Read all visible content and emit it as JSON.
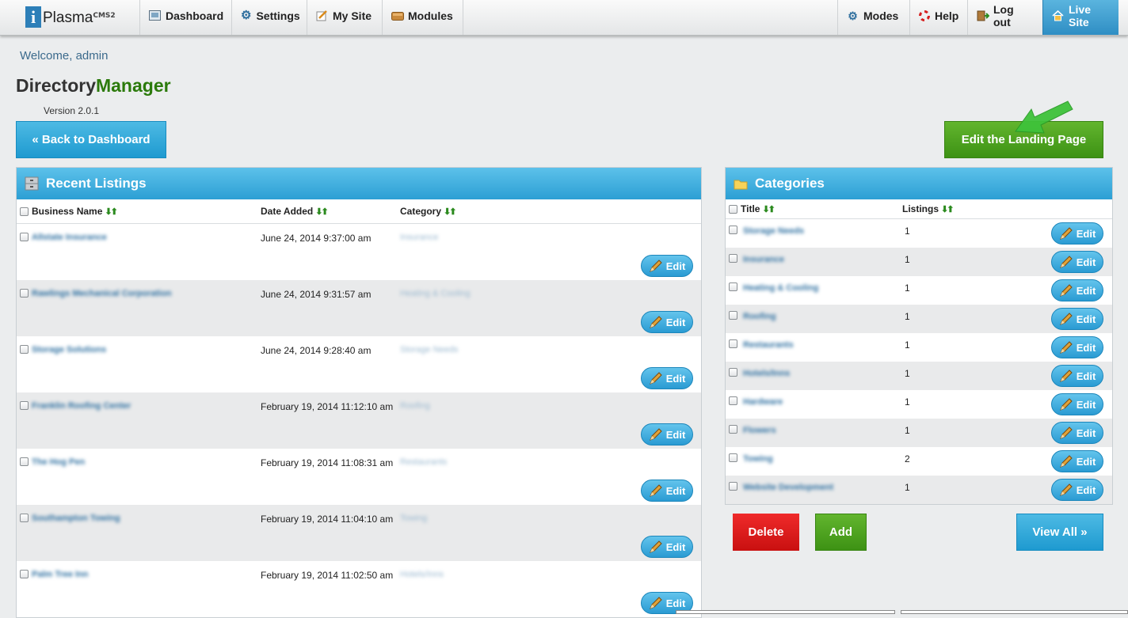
{
  "logo": {
    "word": "Plasma",
    "sup": "CMS2"
  },
  "nav": {
    "left": [
      {
        "label": "Dashboard",
        "icon": "dashboard-icon"
      },
      {
        "label": "Settings",
        "icon": "gear-icon"
      },
      {
        "label": "My Site",
        "icon": "pencil-page-icon"
      },
      {
        "label": "Modules",
        "icon": "modules-box-icon"
      }
    ],
    "right": [
      {
        "label": "Modes",
        "icon": "gears-icon"
      },
      {
        "label": "Help",
        "icon": "lifebuoy-icon"
      },
      {
        "label": "Log out",
        "icon": "door-icon"
      },
      {
        "label": "Live Site",
        "icon": "home-icon"
      }
    ]
  },
  "welcome": "Welcome, admin",
  "app": {
    "title_a": "Directory",
    "title_b": "Manager",
    "version": "Version 2.0.1"
  },
  "buttons": {
    "back": "« Back to Dashboard",
    "landing": "Edit the Landing Page",
    "edit": "Edit",
    "delete": "Delete",
    "add": "Add",
    "view_all": "View All »"
  },
  "recent": {
    "title": "Recent Listings",
    "columns": {
      "name": "Business Name",
      "date": "Date Added",
      "category": "Category"
    },
    "rows": [
      {
        "name": "Allstate Insurance",
        "date": "June 24, 2014 9:37:00 am",
        "category": "Insurance"
      },
      {
        "name": "Rawlings Mechanical Corporation",
        "date": "June 24, 2014 9:31:57 am",
        "category": "Heating & Cooling"
      },
      {
        "name": "Storage Solutions",
        "date": "June 24, 2014 9:28:40 am",
        "category": "Storage Needs"
      },
      {
        "name": "Franklin Roofing Center",
        "date": "February 19, 2014 11:12:10 am",
        "category": "Roofing"
      },
      {
        "name": "The Hog Pen",
        "date": "February 19, 2014 11:08:31 am",
        "category": "Restaurants"
      },
      {
        "name": "Southampton Towing",
        "date": "February 19, 2014 11:04:10 am",
        "category": "Towing"
      },
      {
        "name": "Palm Tree Inn",
        "date": "February 19, 2014 11:02:50 am",
        "category": "Hotels/Inns"
      }
    ]
  },
  "categories": {
    "title": "Categories",
    "columns": {
      "title": "Title",
      "listings": "Listings"
    },
    "rows": [
      {
        "title": "Storage Needs",
        "listings": "1"
      },
      {
        "title": "Insurance",
        "listings": "1"
      },
      {
        "title": "Heating & Cooling",
        "listings": "1"
      },
      {
        "title": "Roofing",
        "listings": "1"
      },
      {
        "title": "Restaurants",
        "listings": "1"
      },
      {
        "title": "Hotels/Inns",
        "listings": "1"
      },
      {
        "title": "Hardware",
        "listings": "1"
      },
      {
        "title": "Flowers",
        "listings": "1"
      },
      {
        "title": "Towing",
        "listings": "2"
      },
      {
        "title": "Website Development",
        "listings": "1"
      }
    ]
  },
  "colors": {
    "accent_blue": "#2c9fd4",
    "accent_green": "#3d9214",
    "danger_red": "#c91010",
    "brand_green": "#2b7a0b"
  }
}
